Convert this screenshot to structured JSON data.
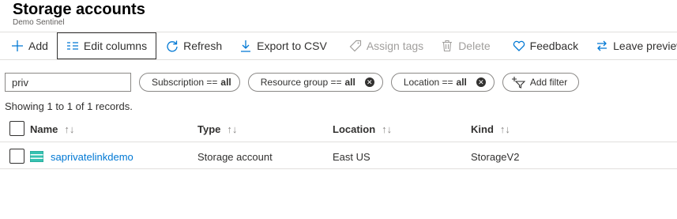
{
  "header": {
    "title": "Storage accounts",
    "subtitle": "Demo Sentinel"
  },
  "toolbar": {
    "add": "Add",
    "edit_columns": "Edit columns",
    "refresh": "Refresh",
    "export": "Export to CSV",
    "assign_tags": "Assign tags",
    "delete": "Delete",
    "feedback": "Feedback",
    "leave_preview": "Leave preview"
  },
  "filters": {
    "search_value": "priv",
    "subscription_label": "Subscription ==",
    "subscription_value": "all",
    "resource_group_label": "Resource group ==",
    "resource_group_value": "all",
    "location_label": "Location ==",
    "location_value": "all",
    "add_filter": "Add filter"
  },
  "records_text": "Showing 1 to 1 of 1 records.",
  "table": {
    "columns": {
      "name": "Name",
      "type": "Type",
      "location": "Location",
      "kind": "Kind"
    },
    "rows": [
      {
        "name": "saprivatelinkdemo",
        "type": "Storage account",
        "location": "East US",
        "kind": "StorageV2"
      }
    ]
  },
  "colors": {
    "accent": "#0078d4",
    "text": "#323130",
    "disabled": "#a19f9d",
    "border": "#e1dfdd"
  }
}
